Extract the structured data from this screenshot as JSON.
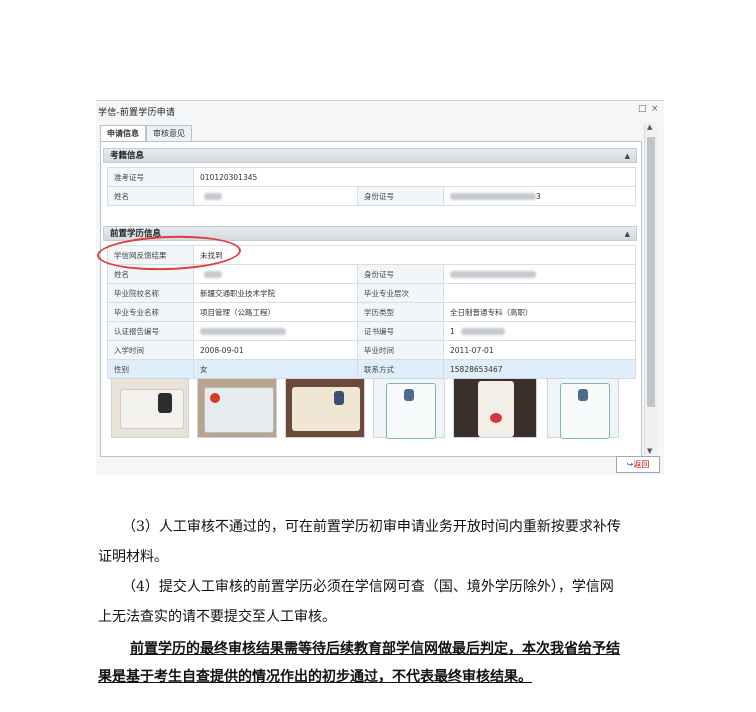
{
  "window": {
    "title": "学信-前置学历申请",
    "controls": [
      "□",
      "×"
    ],
    "tabs": [
      {
        "label": "申请信息",
        "active": true
      },
      {
        "label": "审核意见",
        "active": false
      }
    ],
    "back_label": "返回"
  },
  "section_exam": {
    "heading": "考籍信息",
    "collapse": "▲",
    "rows": [
      {
        "label": "准考证号",
        "value": "010120301345"
      },
      {
        "label": "姓名",
        "label2": "身份证号",
        "value2_suffix": "3"
      }
    ]
  },
  "section_edu": {
    "heading": "前置学历信息",
    "collapse": "▲",
    "rows": [
      {
        "label": "学信网反馈结果",
        "value": "未找到"
      },
      {
        "label": "姓名",
        "label2": "身份证号"
      },
      {
        "label": "毕业院校名称",
        "value": "新疆交通职业技术学院",
        "label2": "毕业专业层次",
        "value2": ""
      },
      {
        "label": "毕业专业名称",
        "value": "项目管理（公路工程）",
        "label2": "学历类型",
        "value2": "全日制普通专科（高职）"
      },
      {
        "label": "认证报告编号",
        "label2": "证书编号",
        "value2_prefix": "1"
      },
      {
        "label": "入学时间",
        "value": "2008-09-01",
        "label2": "毕业时间",
        "value2": "2011-07-01"
      },
      {
        "label": "性别",
        "value": "女",
        "label2": "联系方式",
        "value2": "15828653467"
      }
    ]
  },
  "scrollbar": {
    "up": "▲",
    "down": "▼"
  },
  "paragraphs": {
    "p3_line1": "（3）人工审核不通过的，可在前置学历初审申请业务开放时间内重新按要求补传",
    "p3_line2": "证明材料。",
    "p4_line1": "（4）提交人工审核的前置学历必须在学信网可查（国、境外学历除外），学信网",
    "p4_line2": "上无法查实的请不要提交至人工审核。",
    "note_line1": "前置学历的最终审核结果需等待后续教育部学信网做最后判定，本次我省给予结",
    "note_line2": "果是基于考生自查提供的情况作出的初步通过，不代表最终审核结果。"
  },
  "colors": {
    "highlight_row": "#dfeefa",
    "oval": "#e03a3a",
    "back_text": "#bb0000"
  }
}
